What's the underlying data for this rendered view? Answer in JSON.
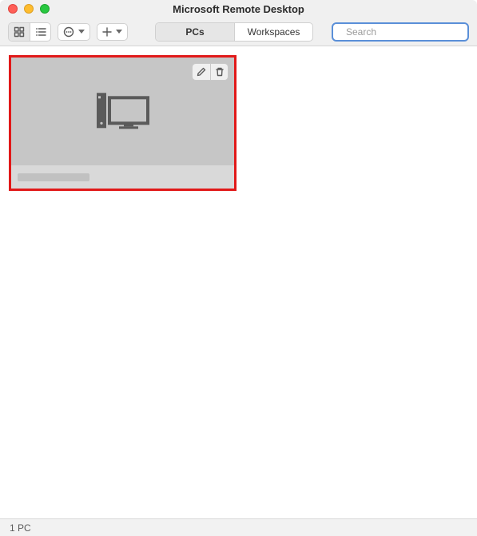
{
  "window": {
    "title": "Microsoft Remote Desktop"
  },
  "toolbar": {
    "view_mode": "grid",
    "tabs": [
      {
        "id": "pcs",
        "label": "PCs",
        "active": true
      },
      {
        "id": "workspaces",
        "label": "Workspaces",
        "active": false
      }
    ]
  },
  "search": {
    "placeholder": "Search",
    "value": ""
  },
  "pcs": [
    {
      "name": "",
      "selected": true
    }
  ],
  "statusbar": {
    "text": "1 PC"
  }
}
